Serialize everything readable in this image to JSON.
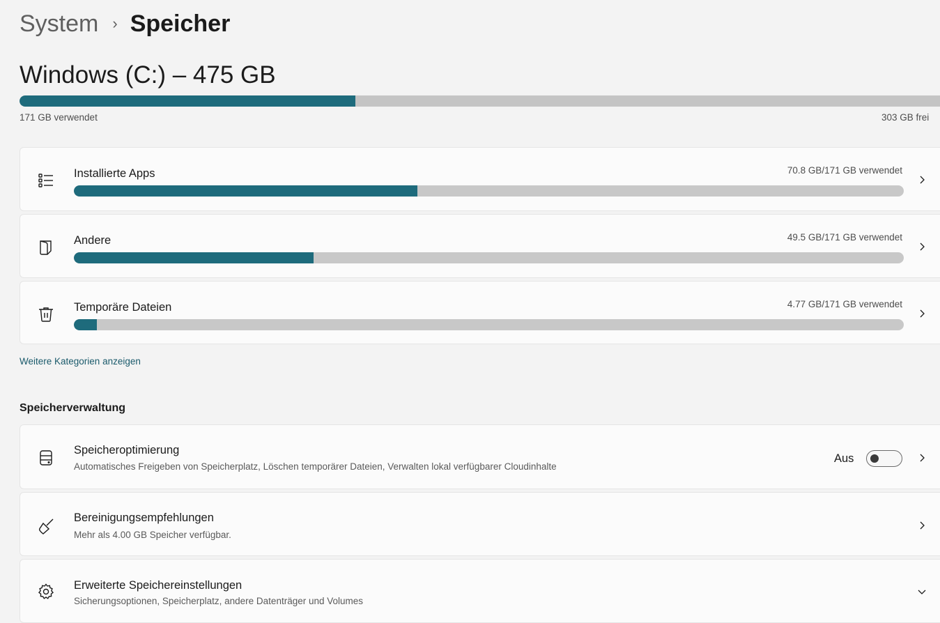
{
  "breadcrumb": {
    "parent": "System",
    "separator": "›",
    "current": "Speicher"
  },
  "drive": {
    "title": "Windows (C:) – 475 GB",
    "used_label": "171 GB verwendet",
    "free_label": "303 GB frei",
    "used_fraction": 0.36
  },
  "categories": [
    {
      "icon": "list-icon",
      "label": "Installierte Apps",
      "value": "70.8 GB/171 GB verwendet",
      "fraction": 0.414
    },
    {
      "icon": "document-icon",
      "label": "Andere",
      "value": "49.5 GB/171 GB verwendet",
      "fraction": 0.289
    },
    {
      "icon": "trash-icon",
      "label": "Temporäre Dateien",
      "value": "4.77 GB/171 GB verwendet",
      "fraction": 0.028
    }
  ],
  "more_categories_link": "Weitere Kategorien anzeigen",
  "management": {
    "title": "Speicherverwaltung",
    "storage_sense": {
      "icon": "storage-drive-icon",
      "title": "Speicheroptimierung",
      "subtitle": "Automatisches Freigeben von Speicherplatz, Löschen temporärer Dateien, Verwalten lokal verfügbarer Cloudinhalte",
      "toggle_label": "Aus",
      "toggle_on": false
    },
    "cleanup": {
      "icon": "broom-icon",
      "title": "Bereinigungsempfehlungen",
      "subtitle": "Mehr als 4.00 GB Speicher verfügbar."
    },
    "advanced": {
      "icon": "gear-icon",
      "title": "Erweiterte Speichereinstellungen",
      "subtitle": "Sicherungsoptionen, Speicherplatz, andere Datenträger und Volumes"
    }
  },
  "colors": {
    "accent": "#1e6b7c",
    "bar_track": "#c4c4c4",
    "link": "#1a5a6b"
  }
}
